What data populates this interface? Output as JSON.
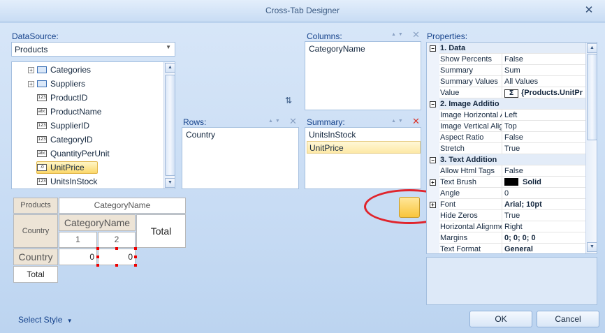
{
  "window": {
    "title": "Cross-Tab Designer"
  },
  "datasource": {
    "label": "DataSource:",
    "selected": "Products",
    "tree": [
      {
        "label": "Categories",
        "icon": "table-icon",
        "type": "table",
        "expandable": true
      },
      {
        "label": "Suppliers",
        "icon": "table-icon",
        "type": "table",
        "expandable": true
      },
      {
        "label": "ProductID",
        "icon": "numeric-field-icon",
        "type": "123"
      },
      {
        "label": "ProductName",
        "icon": "text-field-icon",
        "type": "abc"
      },
      {
        "label": "SupplierID",
        "icon": "numeric-field-icon",
        "type": "123"
      },
      {
        "label": "CategoryID",
        "icon": "numeric-field-icon",
        "type": "123"
      },
      {
        "label": "QuantityPerUnit",
        "icon": "text-field-icon",
        "type": "abc"
      },
      {
        "label": "UnitPrice",
        "icon": "decimal-field-icon",
        "type": ".0",
        "selected": true
      },
      {
        "label": "UnitsInStock",
        "icon": "numeric-field-icon",
        "type": "123"
      }
    ]
  },
  "columns": {
    "label": "Columns:",
    "items": [
      "CategoryName"
    ]
  },
  "rows": {
    "label": "Rows:",
    "items": [
      "Country"
    ]
  },
  "summary": {
    "label": "Summary:",
    "items": [
      "UnitsInStock",
      "UnitPrice"
    ],
    "selected_index": 1
  },
  "preview": {
    "corner": "Products",
    "column_header": "CategoryName",
    "row_header": "Country",
    "category_header": "CategoryName",
    "col_index_1": "1",
    "col_index_2": "2",
    "total_col": "Total",
    "row_label": "Country",
    "value_1": "0",
    "value_2": "0",
    "total_row": "Total"
  },
  "properties": {
    "label": "Properties:",
    "rows": [
      {
        "kind": "cat",
        "name": "1. Data"
      },
      {
        "name": "Show Percents",
        "value": "False"
      },
      {
        "name": "Summary",
        "value": "Sum"
      },
      {
        "name": "Summary Values",
        "value": "All Values"
      },
      {
        "name": "Value",
        "value": "{Products.UnitPr",
        "bold": true,
        "sigma": true
      },
      {
        "kind": "cat",
        "name": "2. Image Additio"
      },
      {
        "name": "Image Horizontal A",
        "value": "Left"
      },
      {
        "name": "Image Vertical Alig",
        "value": "Top"
      },
      {
        "name": "Aspect Ratio",
        "value": "False"
      },
      {
        "name": "Stretch",
        "value": "True"
      },
      {
        "kind": "cat",
        "name": "3. Text Addition"
      },
      {
        "name": "Allow Html Tags",
        "value": "False"
      },
      {
        "name": "Text Brush",
        "value": "Solid",
        "bold": true,
        "swatch": true,
        "expand": true
      },
      {
        "name": "Angle",
        "value": "0"
      },
      {
        "name": "Font",
        "value": "Arial; 10pt",
        "bold": true,
        "expand": true
      },
      {
        "name": "Hide Zeros",
        "value": "True"
      },
      {
        "name": "Horizontal Alignme",
        "value": "Right"
      },
      {
        "name": "Margins",
        "value": "0; 0; 0; 0",
        "bold": true
      },
      {
        "name": "Text Format",
        "value": "General",
        "bold": true
      }
    ]
  },
  "footer": {
    "select_style": "Select Style",
    "ok": "OK",
    "cancel": "Cancel"
  },
  "colors": {
    "annotation_red": "#e0242c",
    "selection_yellow": "#fbd76a",
    "accent_blue": "#15428b"
  }
}
